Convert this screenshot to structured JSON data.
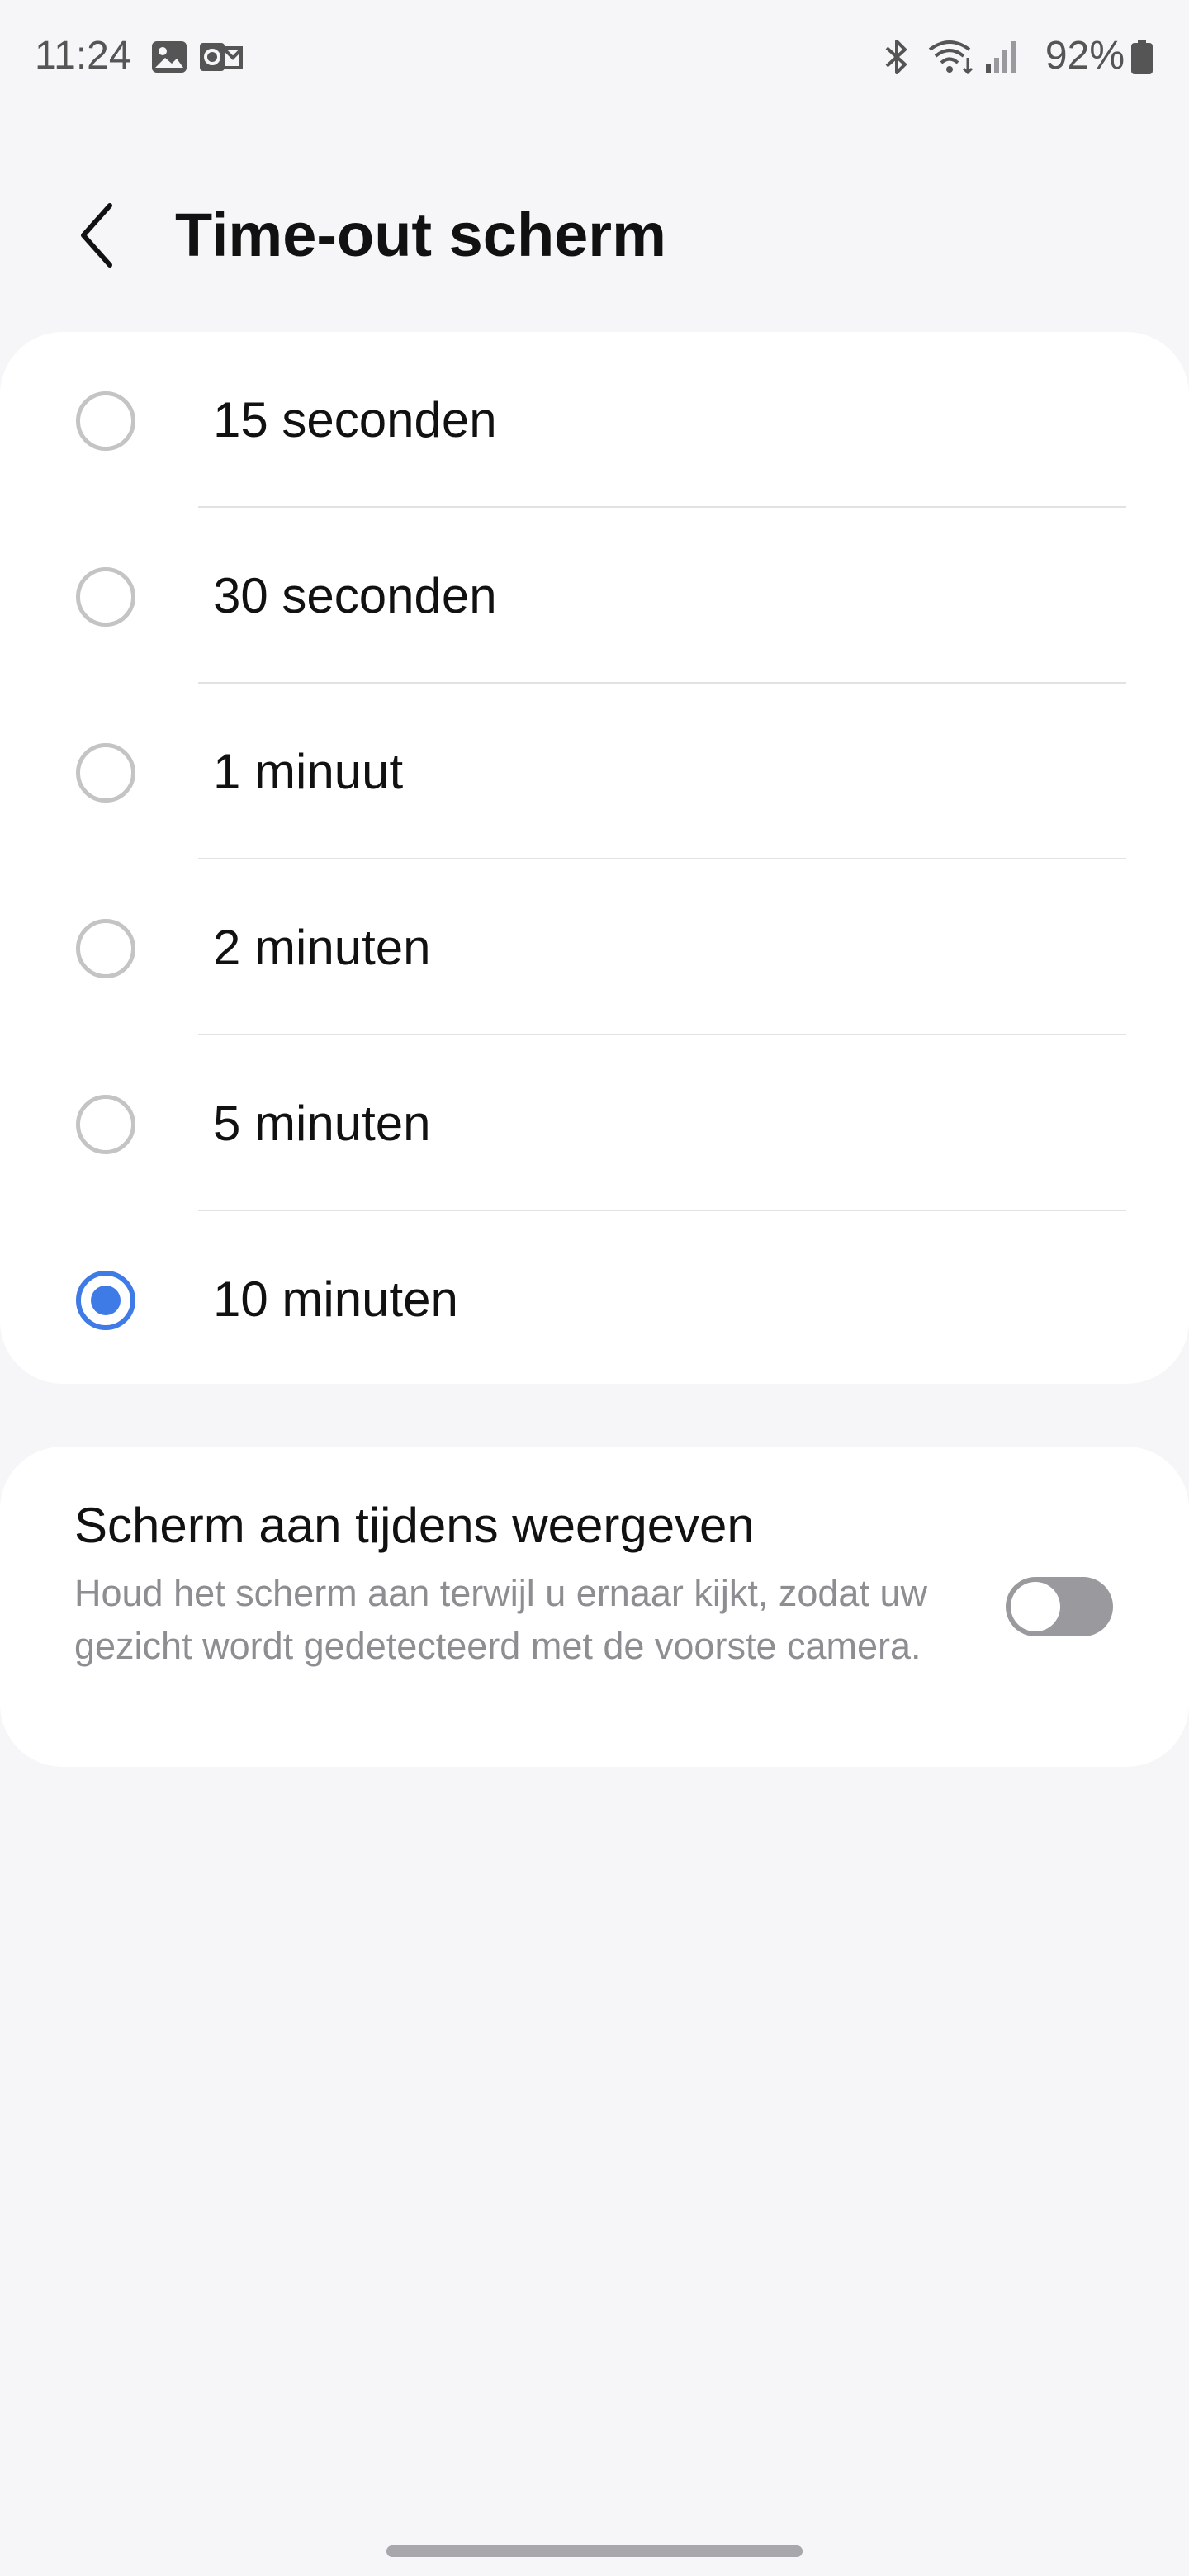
{
  "status_bar": {
    "time": "11:24",
    "left_icons": [
      "gallery-icon",
      "outlook-icon"
    ],
    "right_icons": [
      "bluetooth-icon",
      "wifi-icon",
      "signal-icon",
      "battery-icon"
    ],
    "battery_percent": "92%"
  },
  "header": {
    "back_icon": "chevron-left-icon",
    "title": "Time-out scherm"
  },
  "options": [
    {
      "label": "15 seconden",
      "selected": false
    },
    {
      "label": "30 seconden",
      "selected": false
    },
    {
      "label": "1 minuut",
      "selected": false
    },
    {
      "label": "2 minuten",
      "selected": false
    },
    {
      "label": "5 minuten",
      "selected": false
    },
    {
      "label": "10 minuten",
      "selected": true
    }
  ],
  "keep_screen_on": {
    "title": "Scherm aan tijdens weergeven",
    "description": "Houd het scherm aan terwijl u ernaar kijkt, zodat uw gezicht wordt gedetecteerd met de voorste camera.",
    "enabled": false
  },
  "colors": {
    "accent": "#3e7be6",
    "background": "#f6f6f8",
    "card": "#ffffff",
    "toggle_off": "#9a9a9e",
    "secondary_text": "#8e8e92"
  }
}
